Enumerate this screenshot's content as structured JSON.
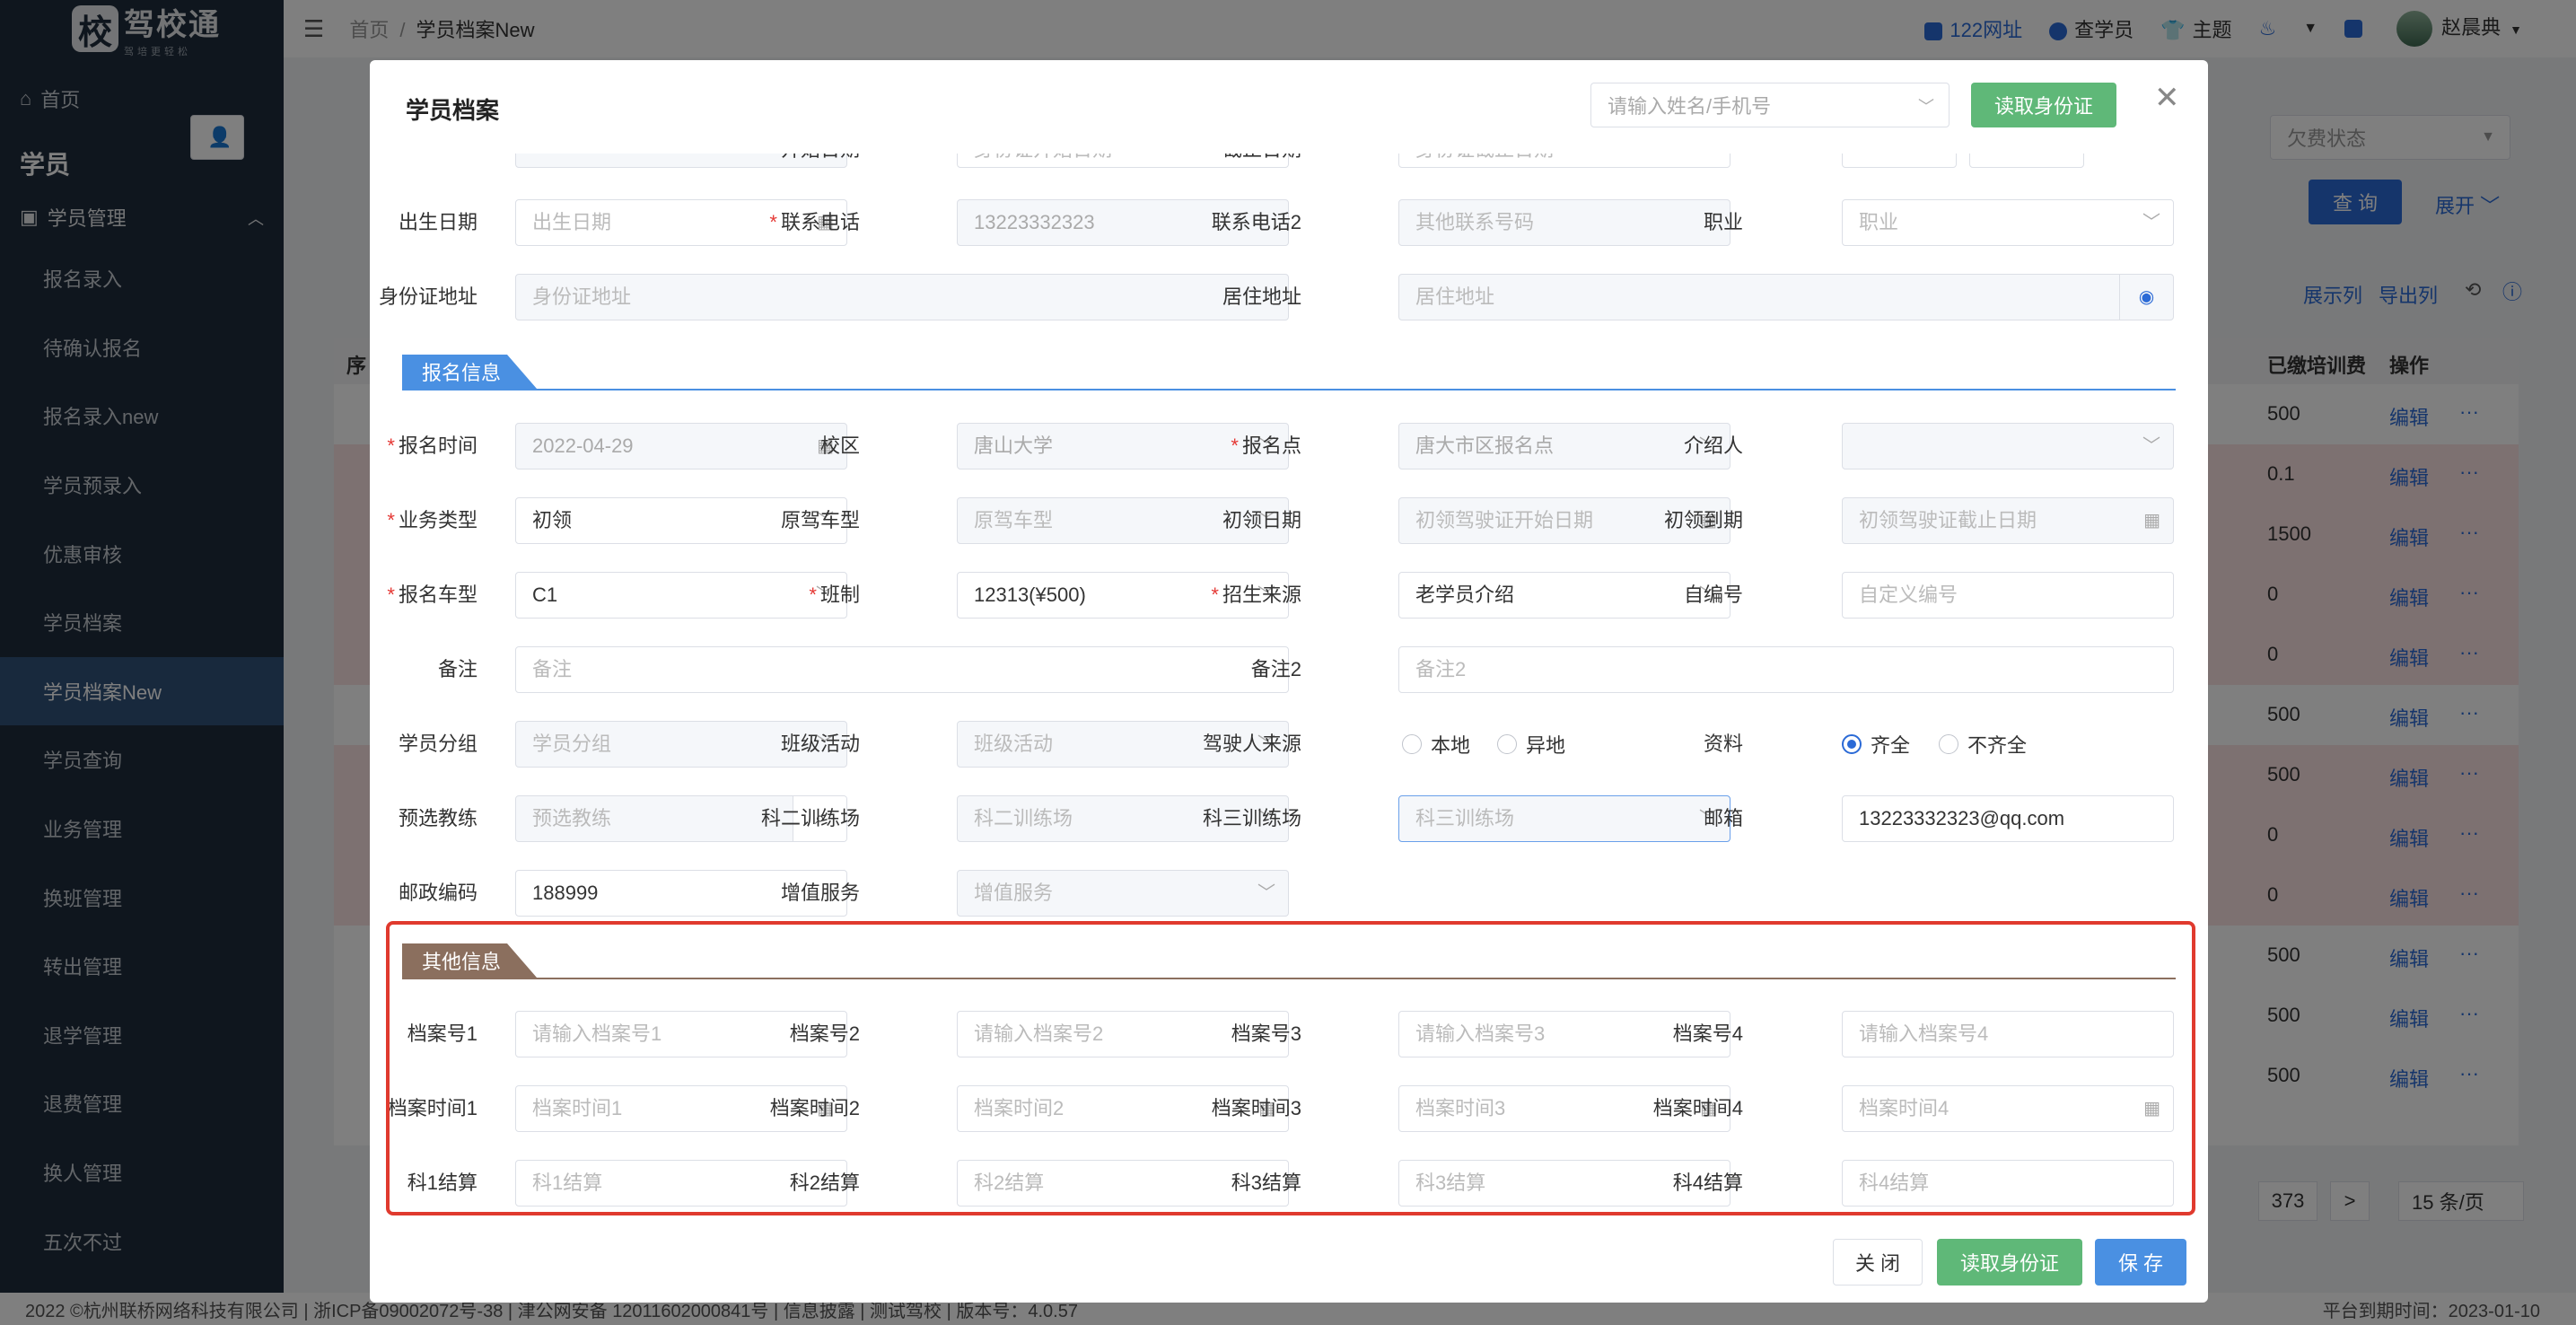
{
  "sidebar": {
    "logo_name": "驾校通",
    "logo_slogan": "驾培更轻松",
    "logo_char": "校",
    "home": "首页",
    "section": "学员",
    "group": "学员管理",
    "items": [
      "报名录入",
      "待确认报名",
      "报名录入new",
      "学员预录入",
      "优惠审核",
      "学员档案",
      "学员档案New",
      "学员查询",
      "业务管理",
      "换班管理",
      "转出管理",
      "退学管理",
      "退费管理",
      "换人管理",
      "五次不过"
    ],
    "active_index": 6
  },
  "header": {
    "breadcrumb_home": "首页",
    "breadcrumb_sep": "/",
    "breadcrumb_current": "学员档案New",
    "link_122": "122网址",
    "link_check": "查学员",
    "link_theme": "主题",
    "user": "赵晨典"
  },
  "bgpage": {
    "filter_fee_status": "欠费状态",
    "btn_query": "查 询",
    "link_expand": "展开",
    "link_show_cols": "展示列",
    "link_export": "导出列",
    "col_fee": "已缴培训费",
    "col_ops": "操作",
    "col_seq": "序",
    "rows": [
      {
        "fee": "500",
        "red": false
      },
      {
        "fee": "0.1",
        "red": true
      },
      {
        "fee": "1500",
        "red": true
      },
      {
        "fee": "0",
        "red": true
      },
      {
        "fee": "0",
        "red": true
      },
      {
        "fee": "500",
        "red": false
      },
      {
        "fee": "500",
        "red": true
      },
      {
        "fee": "0",
        "red": true
      },
      {
        "fee": "0",
        "red": true
      },
      {
        "fee": "500",
        "red": false
      },
      {
        "fee": "500",
        "red": false
      },
      {
        "fee": "500",
        "red": false
      }
    ],
    "edit_label": "编辑",
    "more_label": "···",
    "page_total": "373",
    "page_size": "15 条/页",
    "footer_text": "2022 ©杭州联桥网络科技有限公司 | 浙ICP备09002072号-38 | 津公网安备 12011602000841号 | 信息披露 | 测试驾校 | 版本号：4.0.57",
    "expire_text": "平台到期时间：2023-01-10"
  },
  "modal": {
    "title": "学员档案",
    "search_placeholder": "请输入姓名/手机号",
    "read_id_label": "读取身份证",
    "partial_top": {
      "label_start": "开始日期",
      "placeholder_start": "身份证开始日期",
      "label_end": "截止日期",
      "placeholder_end": "身份证截止日期"
    },
    "basic": {
      "birth_label": "出生日期",
      "birth_placeholder": "出生日期",
      "phone_label": "联系电话",
      "phone_value": "13223332323",
      "phone2_label": "联系电话2",
      "phone2_placeholder": "其他联系号码",
      "job_label": "职业",
      "job_placeholder": "职业",
      "idaddr_label": "身份证地址",
      "idaddr_placeholder": "身份证地址",
      "live_label": "居住地址",
      "live_placeholder": "居住地址"
    },
    "reg_section": "报名信息",
    "reg": {
      "time_label": "报名时间",
      "time_value": "2022-04-29",
      "campus_label": "校区",
      "campus_value": "唐山大学",
      "point_label": "报名点",
      "point_value": "唐大市区报名点",
      "referrer_label": "介绍人",
      "biz_label": "业务类型",
      "biz_value": "初领",
      "orig_car_label": "原驾车型",
      "orig_car_placeholder": "原驾车型",
      "first_date_label": "初领日期",
      "first_date_placeholder": "初领驾驶证开始日期",
      "first_exp_label": "初领到期",
      "first_exp_placeholder": "初领驾驶证截止日期",
      "car_label": "报名车型",
      "car_value": "C1",
      "class_label": "班制",
      "class_value": "12313(¥500)",
      "source_label": "招生来源",
      "source_value": "老学员介绍",
      "selfno_label": "自编号",
      "selfno_placeholder": "自定义编号",
      "note_label": "备注",
      "note_placeholder": "备注",
      "note2_label": "备注2",
      "note2_placeholder": "备注2",
      "group_label": "学员分组",
      "group_placeholder": "学员分组",
      "activity_label": "班级活动",
      "activity_placeholder": "班级活动",
      "driver_src_label": "驾驶人来源",
      "driver_src_local": "本地",
      "driver_src_other": "异地",
      "docs_label": "资料",
      "docs_full": "齐全",
      "docs_partial": "不齐全",
      "coach_label": "预选教练",
      "coach_placeholder": "预选教练",
      "field2_label": "科二训练场",
      "field2_placeholder": "科二训练场",
      "field3_label": "科三训练场",
      "field3_placeholder": "科三训练场",
      "email_label": "邮箱",
      "email_value": "13223332323@qq.com",
      "zip_label": "邮政编码",
      "zip_value": "188999",
      "vas_label": "增值服务",
      "vas_placeholder": "增值服务"
    },
    "other_section": "其他信息",
    "other": {
      "no1_label": "档案号1",
      "no1_placeholder": "请输入档案号1",
      "no2_label": "档案号2",
      "no2_placeholder": "请输入档案号2",
      "no3_label": "档案号3",
      "no3_placeholder": "请输入档案号3",
      "no4_label": "档案号4",
      "no4_placeholder": "请输入档案号4",
      "t1_label": "档案时间1",
      "t1_placeholder": "档案时间1",
      "t2_label": "档案时间2",
      "t2_placeholder": "档案时间2",
      "t3_label": "档案时间3",
      "t3_placeholder": "档案时间3",
      "t4_label": "档案时间4",
      "t4_placeholder": "档案时间4",
      "s1_label": "科1结算",
      "s1_placeholder": "科1结算",
      "s2_label": "科2结算",
      "s2_placeholder": "科2结算",
      "s3_label": "科3结算",
      "s3_placeholder": "科3结算",
      "s4_label": "科4结算",
      "s4_placeholder": "科4结算"
    },
    "footer": {
      "close_label": "关 闭",
      "read_id_label": "读取身份证",
      "save_label": "保 存"
    }
  },
  "colors": {
    "sidebar_bg": "#1f2d3d",
    "active_item": "#30537a",
    "primary": "#2b6ad6",
    "green": "#5fb878",
    "reg_tag": "#4a90e2",
    "other_tag": "#8b6f5e",
    "highlight": "#e03a2e"
  }
}
